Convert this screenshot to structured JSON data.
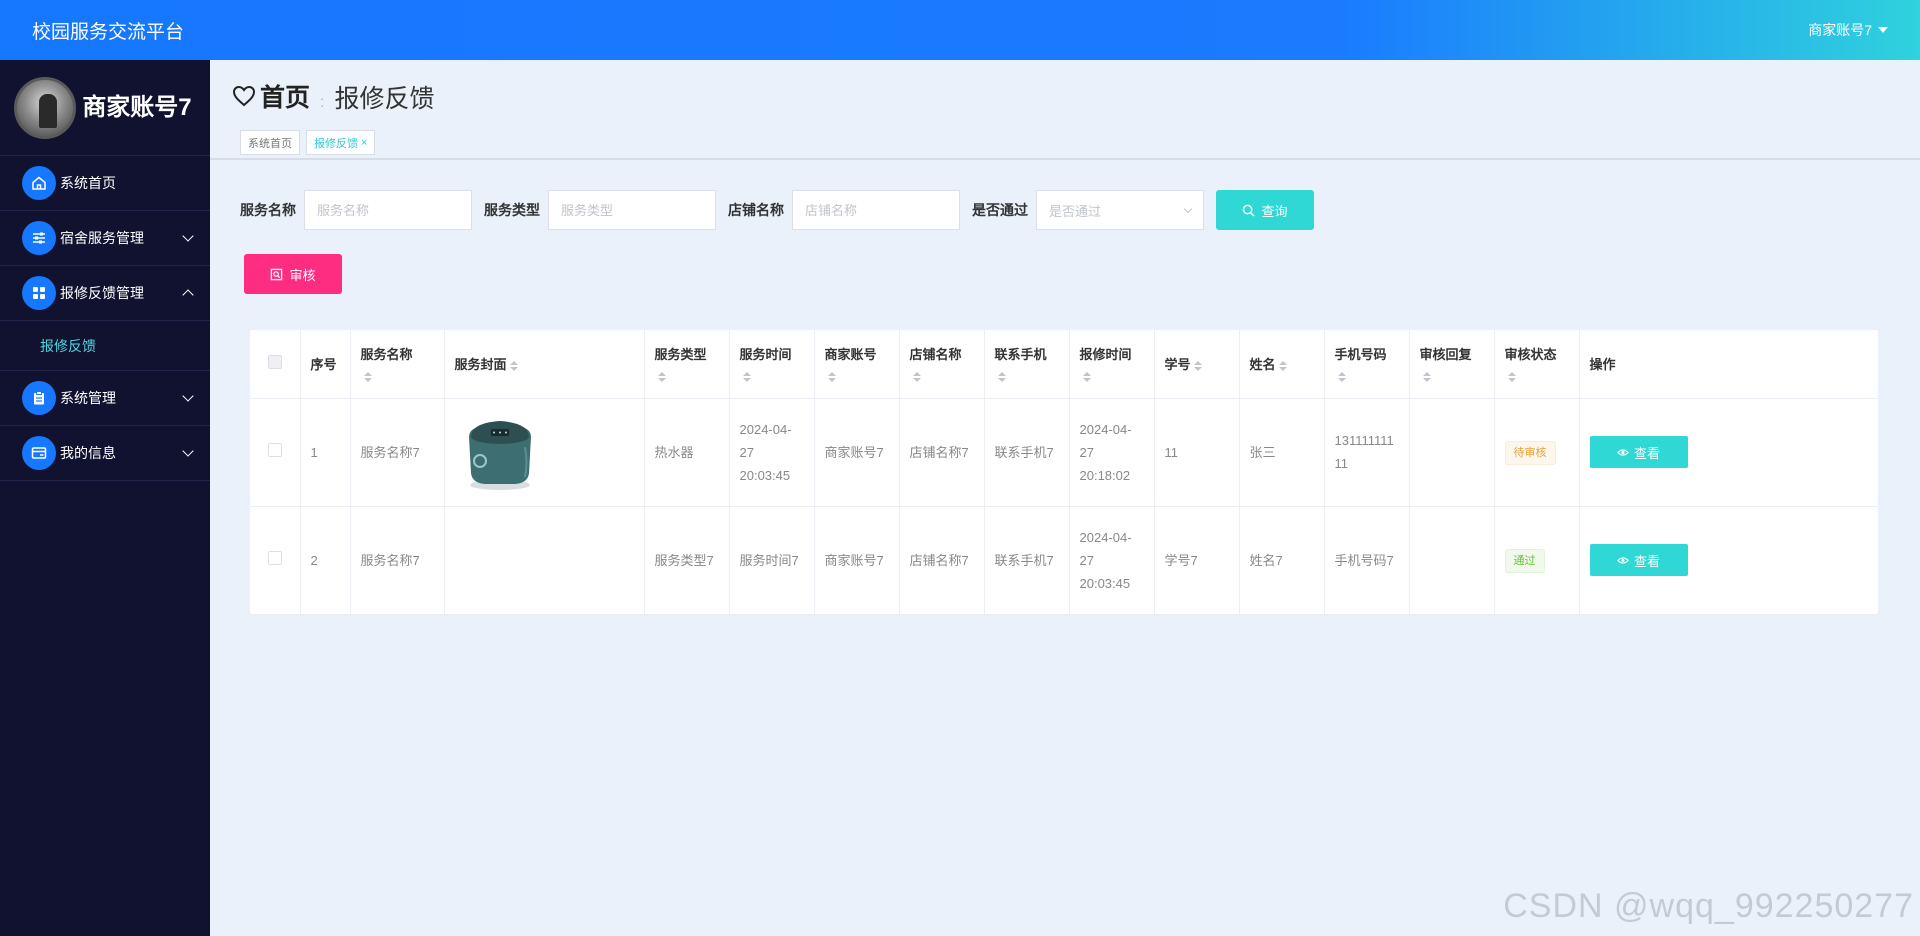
{
  "app": {
    "title": "校园服务交流平台",
    "user_menu": "商家账号7"
  },
  "sidebar": {
    "profile_name": "商家账号7",
    "items": [
      {
        "label": "系统首页",
        "icon": "home-icon"
      },
      {
        "label": "宿舍服务管理",
        "icon": "sliders-icon"
      },
      {
        "label": "报修反馈管理",
        "icon": "grid-icon",
        "sub": "报修反馈"
      },
      {
        "label": "系统管理",
        "icon": "clipboard-icon"
      },
      {
        "label": "我的信息",
        "icon": "card-icon"
      }
    ]
  },
  "breadcrumb": {
    "home": "首页",
    "current": "报修反馈"
  },
  "tabs": [
    {
      "label": "系统首页"
    },
    {
      "label": "报修反馈"
    }
  ],
  "search": {
    "service_name_label": "服务名称",
    "service_name_placeholder": "服务名称",
    "service_type_label": "服务类型",
    "service_type_placeholder": "服务类型",
    "shop_name_label": "店铺名称",
    "shop_name_placeholder": "店铺名称",
    "passed_label": "是否通过",
    "passed_placeholder": "是否通过",
    "query_button": "查询"
  },
  "audit_button": "审核",
  "table": {
    "headers": [
      "序号",
      "服务名称",
      "服务封面",
      "服务类型",
      "服务时间",
      "商家账号",
      "店铺名称",
      "联系手机",
      "报修时间",
      "学号",
      "姓名",
      "手机号码",
      "审核回复",
      "审核状态",
      "操作"
    ],
    "rows": [
      {
        "index": "1",
        "service_name": "服务名称7",
        "cover": "rice-cooker",
        "service_type": "热水器",
        "service_time": "2024-04-27 20:03:45",
        "merchant": "商家账号7",
        "shop": "店铺名称7",
        "phone": "联系手机7",
        "repair_time": "2024-04-27 20:18:02",
        "student_no": "11",
        "name": "张三",
        "mobile": "13111111111",
        "reply": "",
        "status": "待审核",
        "action": "查看"
      },
      {
        "index": "2",
        "service_name": "服务名称7",
        "cover": "",
        "service_type": "服务类型7",
        "service_time": "服务时间7",
        "merchant": "商家账号7",
        "shop": "店铺名称7",
        "phone": "联系手机7",
        "repair_time": "2024-04-27 20:03:45",
        "student_no": "学号7",
        "name": "姓名7",
        "mobile": "手机号码7",
        "reply": "",
        "status": "通过",
        "action": "查看"
      }
    ]
  },
  "watermark": "CSDN @wqq_992250277",
  "colors": {
    "primary": "#1677ff",
    "accent": "#2fd8d4",
    "danger": "#ff2d82",
    "sidebar_bg": "#10122f"
  }
}
